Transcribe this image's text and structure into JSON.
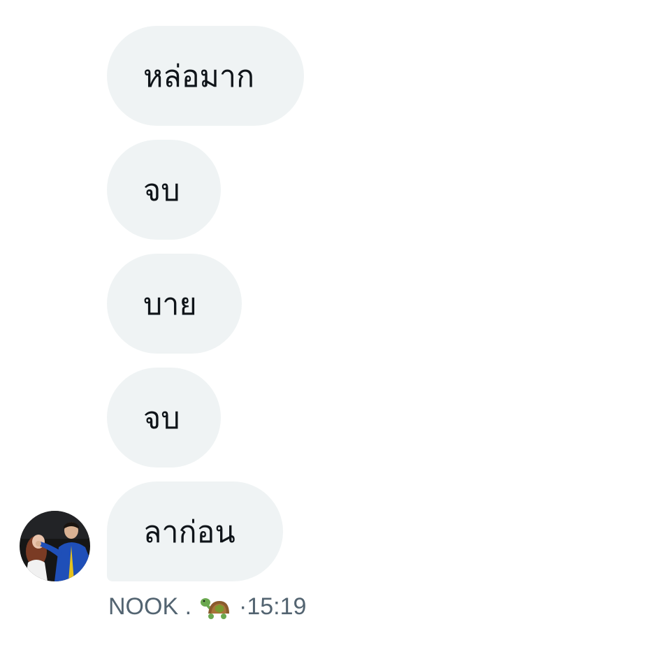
{
  "messages": [
    {
      "text": "หล่อมาก"
    },
    {
      "text": "จบ"
    },
    {
      "text": "บาย"
    },
    {
      "text": "จบ"
    },
    {
      "text": "ลาก่อน"
    }
  ],
  "sender": {
    "name": "NOOK .",
    "emoji_icon": "turtle-icon",
    "separator": "·",
    "time": "15:19"
  },
  "colors": {
    "bubble_bg": "#eff3f4",
    "text": "#0f1419",
    "meta_text": "#536471"
  }
}
